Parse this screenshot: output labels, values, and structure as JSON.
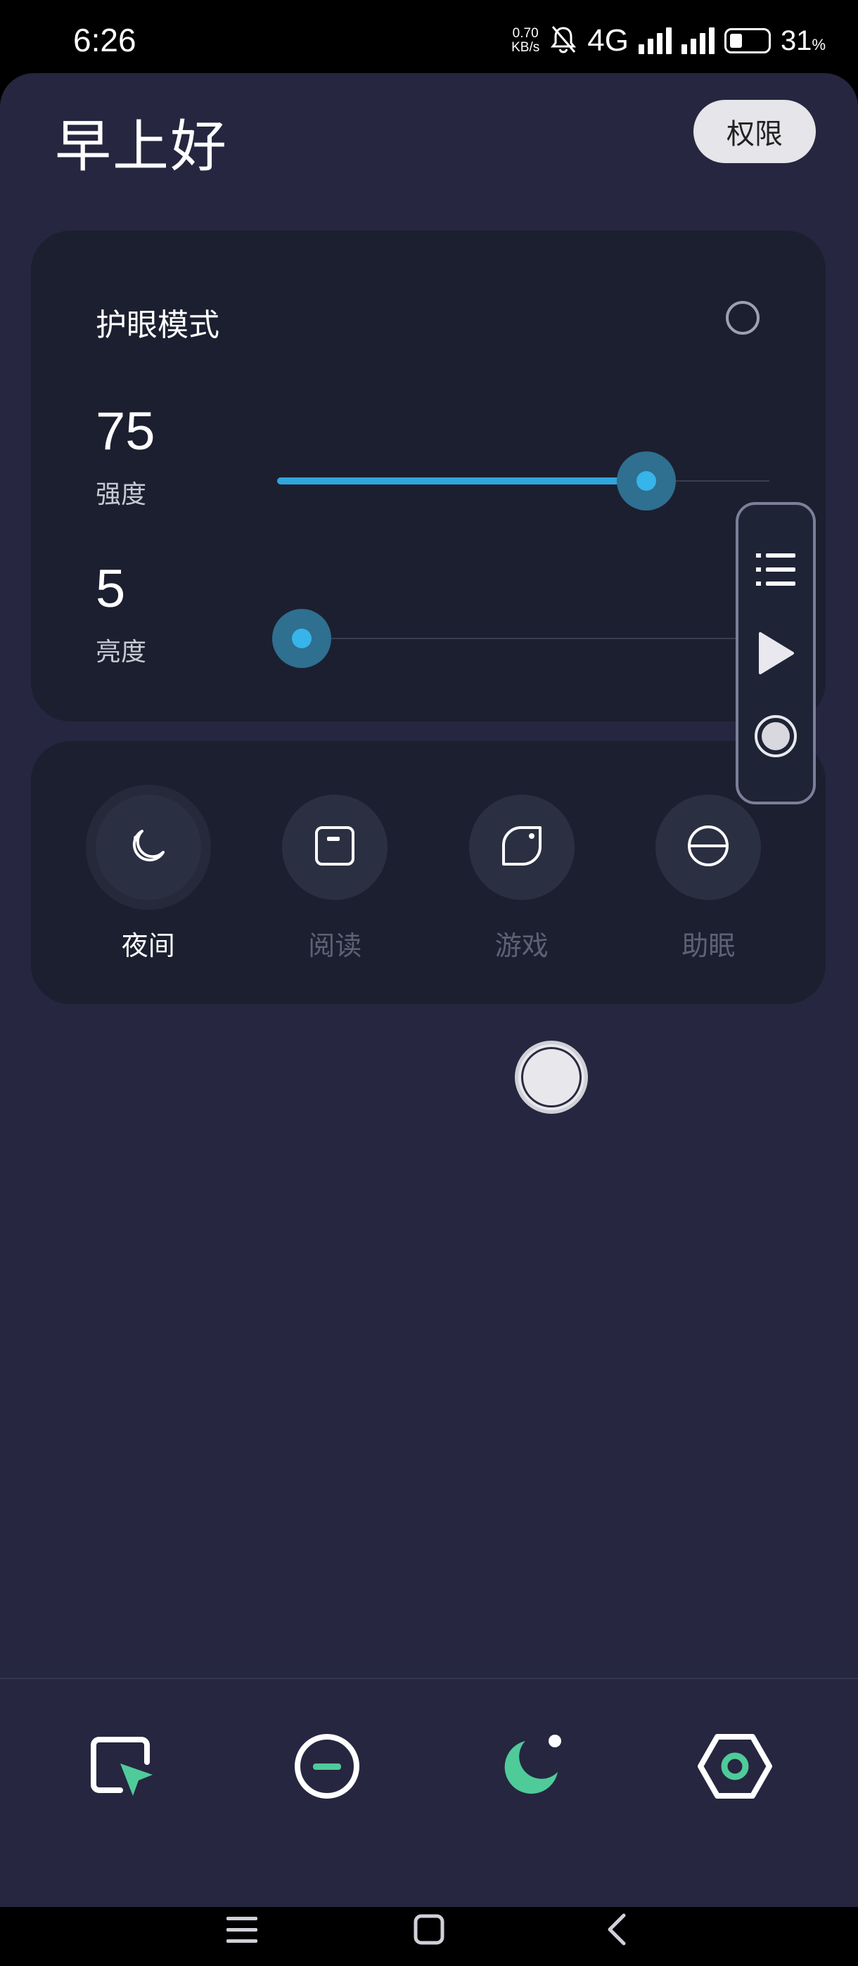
{
  "status_bar": {
    "time": "6:26",
    "net_speed_value": "0.70",
    "net_speed_unit": "KB/s",
    "network_type": "4G",
    "battery_percent": "31",
    "battery_unit": "%",
    "battery_level": 0.31
  },
  "header": {
    "greeting": "早上好",
    "permission_button": "权限"
  },
  "eye_care": {
    "title": "护眼模式",
    "toggle_on": false,
    "intensity": {
      "value": "75",
      "label": "强度",
      "level": 0.75
    },
    "brightness": {
      "value": "5",
      "label": "亮度",
      "level": 0.05
    }
  },
  "modes": [
    {
      "label": "夜间",
      "icon": "moon-icon",
      "active": true
    },
    {
      "label": "阅读",
      "icon": "book-icon",
      "active": false
    },
    {
      "label": "游戏",
      "icon": "leaf-icon",
      "active": false
    },
    {
      "label": "助眠",
      "icon": "half-circle-icon",
      "active": false
    }
  ],
  "floating_panel": {
    "buttons": [
      "list-icon",
      "play-icon",
      "record-icon"
    ]
  },
  "bottom_nav": {
    "items": [
      "cursor-icon",
      "minus-circle-icon",
      "moon-icon",
      "settings-icon"
    ],
    "accent_color": "#4fcb9a"
  },
  "system_nav": [
    "menu-icon",
    "home-icon",
    "back-icon"
  ]
}
